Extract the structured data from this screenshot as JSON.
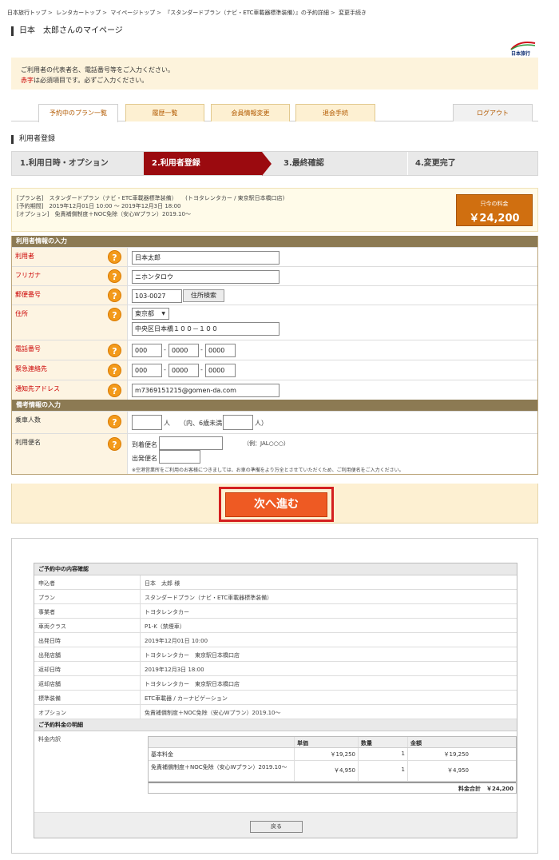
{
  "breadcrumb": [
    "日本旅行トップ",
    "レンタカートップ",
    "マイページトップ",
    "『スタンダードプラン（ナビ・ETC車載器標準装備）』の予約詳細",
    "変更手続き"
  ],
  "page_title": "日本　太郎さんのマイページ",
  "logo_text": "日本旅行",
  "notice": {
    "line1": "ご利用者の代表者名、電話番号等をご入力ください。",
    "req_word": "赤字",
    "line2_rest": "は必須項目です。必ずご入力ください。"
  },
  "tabs": [
    "予約中のプラン一覧",
    "履歴一覧",
    "会員情報変更",
    "退会手続",
    "ログアウト"
  ],
  "section_title": "利用者登録",
  "steps": [
    "1.利用日時・オプション",
    "2.利用者登録",
    "3.最終確認",
    "4.変更完了"
  ],
  "plan": {
    "line1": "[プラン名]　スタンダードプラン（ナビ・ETC車載器標準装備）　　(トヨタレンタカー / 東京駅日本橋口店)",
    "line2": "[予約期間]　2019年12月01日 10:00 ～ 2019年12月3日 18:00",
    "line3": "[オプション]　免責補償制度＋NOC免除（安心Wプラン）2019.10～",
    "price_label": "只今の料金",
    "price_value": "￥24,200"
  },
  "form": {
    "header1": "利用者情報の入力",
    "user_label": "利用者",
    "user_value": "日本太郎",
    "kana_label": "フリガナ",
    "kana_value": "ニホンタロウ",
    "zip_label": "郵便番号",
    "zip_value": "103-0027",
    "zip_button": "住所検索",
    "addr_label": "住所",
    "pref_value": "東京都",
    "addr_value": "中央区日本橋１００－１００",
    "tel_label": "電話番号",
    "tel1": "000",
    "tel2": "0000",
    "tel3": "0000",
    "emg_label": "緊急連絡先",
    "emg1": "000",
    "emg2": "0000",
    "emg3": "0000",
    "mail_label": "通知先アドレス",
    "mail_value": "m7369151215@gomen-da.com",
    "header2": "備考情報の入力",
    "pax_label": "乗車人数",
    "pax_unit": "人",
    "pax_child": "（内、6歳未満",
    "pax_end": "人）",
    "flight_label": "利用便名",
    "arr_label": "到着便名",
    "arr_example": "（例：JAL○○○）",
    "dep_label": "出発便名",
    "flight_note": "※空港営業所をご利用のお客様につきましては、お車の準備をより万全とさせていただくため、ご利用便名をご入力ください。"
  },
  "next_button": "次へ進む",
  "confirm": {
    "header": "ご予約中の内容確認",
    "rows": [
      {
        "k": "申込者",
        "v": "日本　太郎 様"
      },
      {
        "k": "プラン",
        "v": "スタンダードプラン（ナビ・ETC車載器標準装備）"
      },
      {
        "k": "事業者",
        "v": "トヨタレンタカー"
      },
      {
        "k": "車両クラス",
        "v": "P1-K（禁煙車）"
      },
      {
        "k": "出発日時",
        "v": "2019年12月01日 10:00"
      },
      {
        "k": "出発店舗",
        "v": "トヨタレンタカー　東京駅日本橋口店"
      },
      {
        "k": "返却日時",
        "v": "2019年12月3日 18:00"
      },
      {
        "k": "返却店舗",
        "v": "トヨタレンタカー　東京駅日本橋口店"
      },
      {
        "k": "標準装備",
        "v": "ETC車載器 / カーナビゲーション"
      },
      {
        "k": "オプション",
        "v": "免責補償制度＋NOC免除（安心Wプラン）2019.10～"
      }
    ],
    "header2": "ご予約料金の明細",
    "fee_label": "料金内訳",
    "cols": [
      "単価",
      "数量",
      "金額"
    ],
    "items": [
      {
        "name": "基本料金",
        "unit": "￥19,250",
        "qty": "1",
        "amount": "￥19,250"
      },
      {
        "name": "免責補償制度＋NOC免除（安心Wプラン）2019.10～",
        "unit": "￥4,950",
        "qty": "1",
        "amount": "￥4,950"
      }
    ],
    "total_label": "料金合計",
    "total_value": "￥24,200",
    "back_button": "戻る"
  }
}
